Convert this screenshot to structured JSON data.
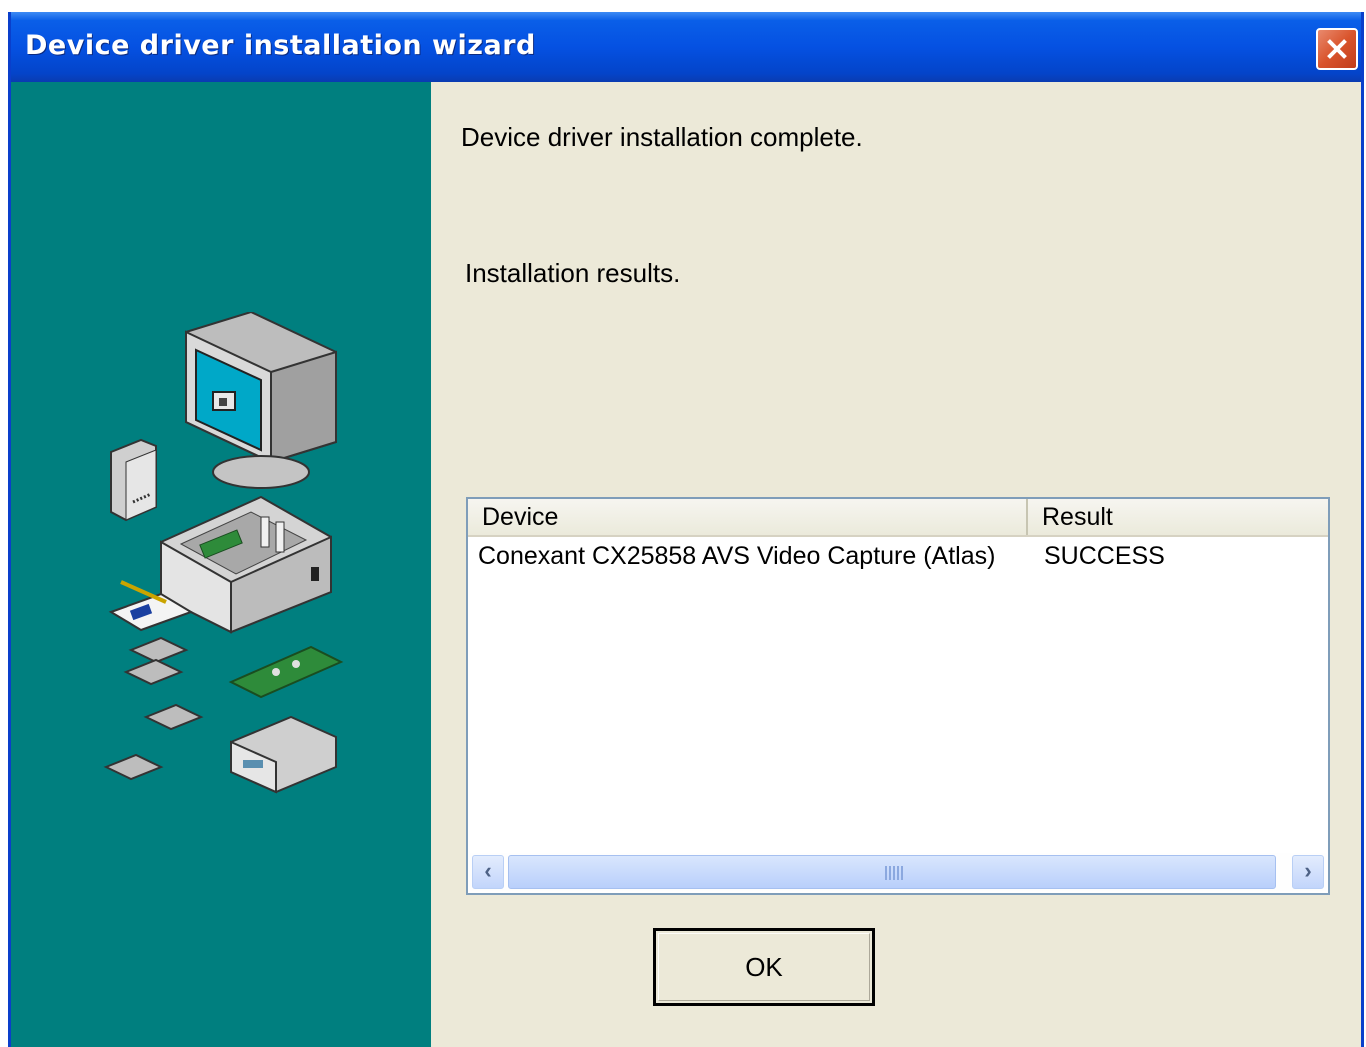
{
  "window": {
    "title": "Device driver installation wizard",
    "close_icon": "close-icon"
  },
  "content": {
    "status_message": "Device driver installation complete.",
    "results_label": "Installation results."
  },
  "results_table": {
    "columns": [
      "Device",
      "Result"
    ],
    "rows": [
      {
        "device": "Conexant CX25858 AVS Video Capture (Atlas)",
        "result": "SUCCESS"
      }
    ]
  },
  "buttons": {
    "ok_label": "OK"
  },
  "colors": {
    "side_panel": "#007f7f",
    "title_bar": "#0551e2",
    "dialog_background": "#ece9d8"
  },
  "illustration": {
    "icon": "computer-hardware-illustration"
  }
}
